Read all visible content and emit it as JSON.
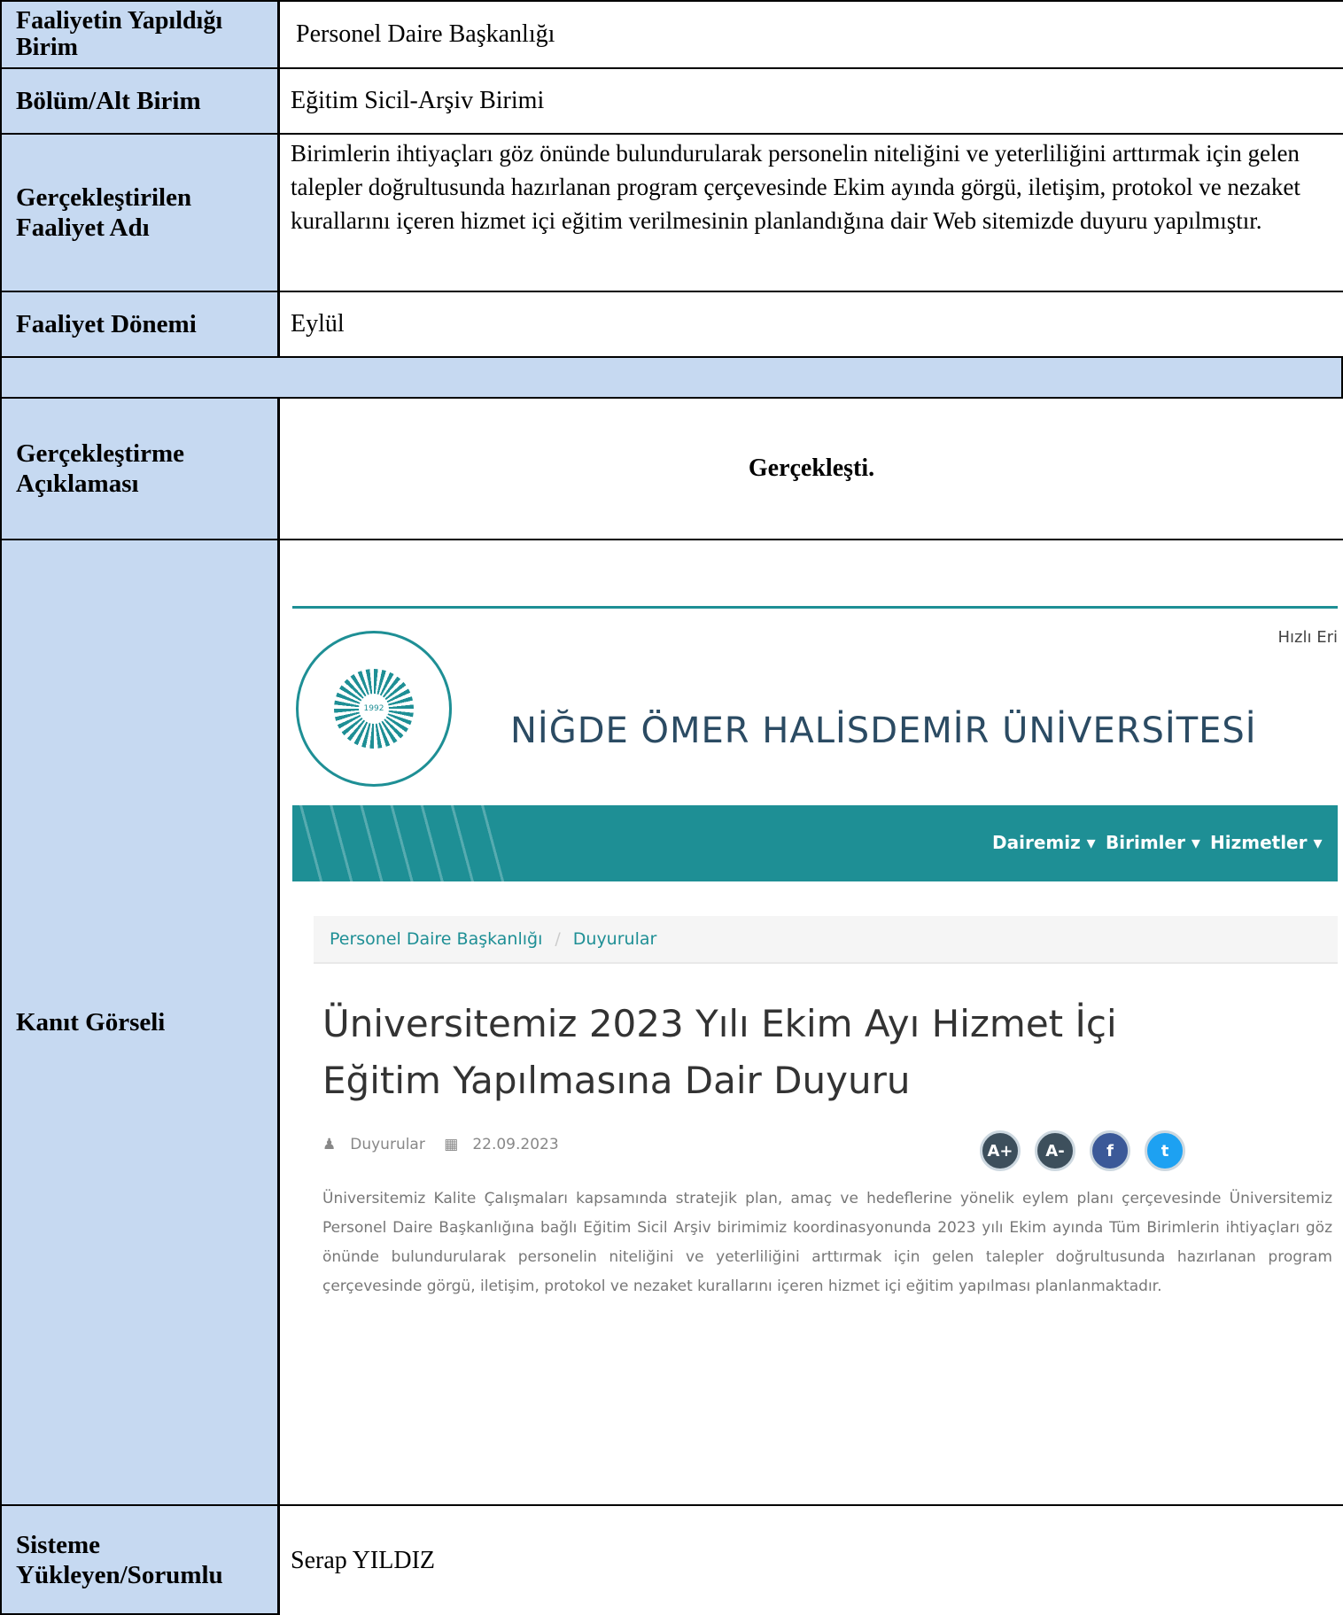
{
  "rows": {
    "birim": {
      "label": "Faaliyetin Yapıldığı Birim",
      "value": "Personel Daire Başkanlığı"
    },
    "alt_birim": {
      "label": "Bölüm/Alt Birim",
      "value": "Eğitim Sicil-Arşiv Birimi"
    },
    "faaliyet_adi": {
      "label": "Gerçekleştirilen Faaliyet Adı",
      "value": "Birimlerin ihtiyaçları göz önünde bulundurularak personelin niteliğini ve yeterliliğini arttırmak için gelen talepler doğrultusunda hazırlanan program çerçevesinde Ekim ayında görgü, iletişim, protokol ve nezaket kurallarını içeren hizmet içi eğitim verilmesinin planlandığına dair Web sitemizde duyuru yapılmıştır."
    },
    "donem": {
      "label": "Faaliyet Dönemi",
      "value": "Eylül"
    },
    "aciklama": {
      "label": "Gerçekleştirme Açıklaması",
      "value": "Gerçekleşti."
    },
    "kanit": {
      "label": "Kanıt Görseli"
    },
    "sorumlu": {
      "label": "Sisteme Yükleyen/Sorumlu",
      "value": "Serap YILDIZ"
    }
  },
  "evidence": {
    "quick_link": "Hızlı Eri",
    "university": "NİĞDE ÖMER HALİSDEMİR ÜNİVERSİTESİ",
    "logo_year": "1992",
    "logo_ring": "NİĞDE ÖMER HALİSDEMİR ÜNİVERSİTESİ",
    "nav": [
      "Dairemiz ▾",
      "Birimler ▾",
      "Hizmetler ▾"
    ],
    "breadcrumb": [
      "Personel Daire Başkanlığı",
      "Duyurular"
    ],
    "breadcrumb_sep": "/",
    "headline": "Üniversitemiz 2023 Yılı Ekim Ayı Hizmet İçi Eğitim Yapılmasına Dair Duyuru",
    "category": "Duyurular",
    "date": "22.09.2023",
    "social": [
      "A+",
      "A-",
      "f",
      "t"
    ],
    "body": "Üniversitemiz Kalite Çalışmaları kapsamında stratejik plan, amaç ve hedeflerine yönelik eylem planı çerçevesinde Üniversitemiz Personel Daire Başkanlığına bağlı Eğitim Sicil Arşiv birimimiz koordinasyonunda 2023 yılı Ekim ayında Tüm Birimlerin ihtiyaçları göz önünde bulundurularak personelin niteliğini ve yeterliliğini arttırmak için gelen talepler doğrultusunda hazırlanan program çerçevesinde görgü, iletişim, protokol ve nezaket kurallarını içeren hizmet içi eğitim yapılması planlanmaktadır.",
    "colors": {
      "teal": "#1e8f95",
      "label_blue": "#c6d9f1"
    }
  }
}
